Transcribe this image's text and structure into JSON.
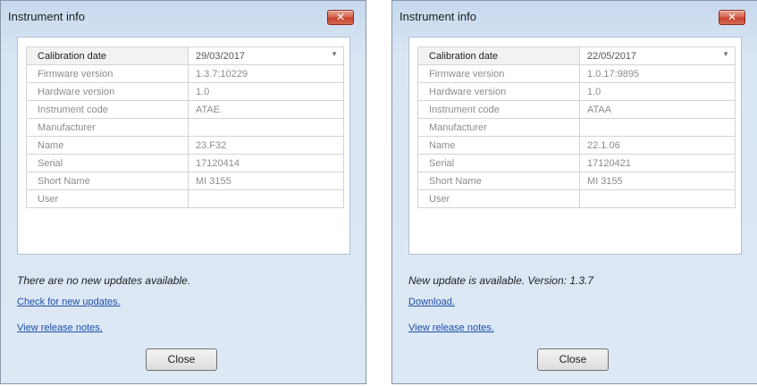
{
  "dialogs": [
    {
      "title": "Instrument info",
      "close_glyph": "✕",
      "rows": [
        {
          "label": "Calibration date",
          "value": "29/03/2017"
        },
        {
          "label": "Firmware version",
          "value": "1.3.7:10229"
        },
        {
          "label": "Hardware version",
          "value": "1.0"
        },
        {
          "label": "Instrument code",
          "value": "ATAE"
        },
        {
          "label": "Manufacturer",
          "value": ""
        },
        {
          "label": "Name",
          "value": "23.F32"
        },
        {
          "label": "Serial",
          "value": "17120414"
        },
        {
          "label": "Short Name",
          "value": "MI 3155"
        },
        {
          "label": "User",
          "value": ""
        }
      ],
      "message": "There are no new updates available.",
      "link1": "Check for new updates.",
      "link2": "View release notes.",
      "close_button": "Close"
    },
    {
      "title": "Instrument info",
      "close_glyph": "✕",
      "rows": [
        {
          "label": "Calibration date",
          "value": "22/05/2017"
        },
        {
          "label": "Firmware version",
          "value": "1.0.17:9895"
        },
        {
          "label": "Hardware version",
          "value": "1.0"
        },
        {
          "label": "Instrument code",
          "value": "ATAA"
        },
        {
          "label": "Manufacturer",
          "value": ""
        },
        {
          "label": "Name",
          "value": "22.1.06"
        },
        {
          "label": "Serial",
          "value": "17120421"
        },
        {
          "label": "Short Name",
          "value": "MI 3155"
        },
        {
          "label": "User",
          "value": ""
        }
      ],
      "message": "New update is available. Version: 1.3.7",
      "link1": "Download.",
      "link2": "View release notes.",
      "close_button": "Close"
    }
  ],
  "icons": {
    "close": "close-icon",
    "dropdown": "chevron-down-icon"
  },
  "colors": {
    "dialog_background": "#d8e5f3",
    "close_button": "#c5402c",
    "link": "#1f4fa6"
  }
}
